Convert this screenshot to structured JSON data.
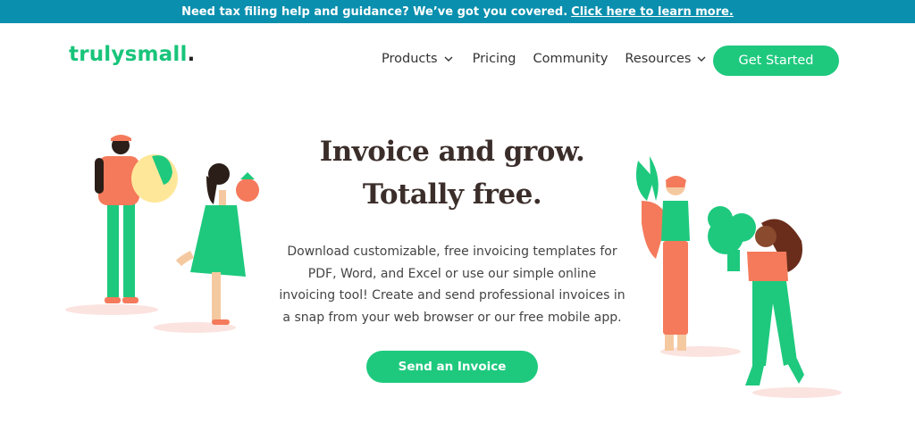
{
  "banner": {
    "text": "Need tax filing help and guidance? We’ve got you covered.",
    "link": "Click here to learn more."
  },
  "logo": {
    "text": "trulysmall",
    "dot": "."
  },
  "nav": {
    "products": "Products",
    "pricing": "Pricing",
    "community": "Community",
    "resources": "Resources"
  },
  "cta_top": "Get Started",
  "hero": {
    "title_line1": "Invoice and grow.",
    "title_line2": "Totally free.",
    "description": "Download customizable, free invoicing templates for PDF, Word, and Excel or use our simple online invoicing tool! Create and send professional invoices in a snap from your web browser or our free mobile app.",
    "cta": "Send an Invoice"
  },
  "colors": {
    "banner_bg": "#0a8fae",
    "brand_green": "#1ec97e",
    "title_color": "#3b2e2a"
  },
  "icons": [
    "chevron-down-icon"
  ]
}
